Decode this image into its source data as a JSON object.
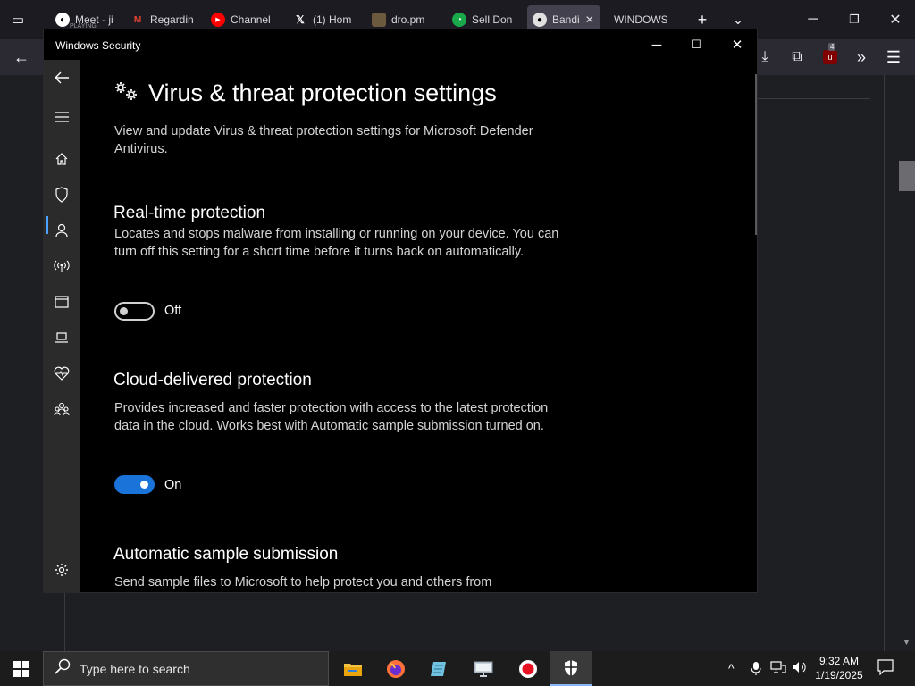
{
  "browser": {
    "tabs": [
      {
        "label": "Meet - ji",
        "sub": "PLAYING",
        "icon": "meet-icon"
      },
      {
        "label": "Regardin",
        "icon": "gmail-icon"
      },
      {
        "label": "Channel",
        "icon": "youtube-icon"
      },
      {
        "label": "(1) Hom",
        "icon": "x-icon"
      },
      {
        "label": "dro.pm",
        "icon": "dropm-icon"
      },
      {
        "label": "Sell Don",
        "icon": "sell-icon"
      },
      {
        "label": "Bandi",
        "icon": "github-icon",
        "active": true
      },
      {
        "label": "WINDOWS",
        "icon": ""
      }
    ],
    "new_tab": "+",
    "badge_count": "4"
  },
  "window": {
    "title": "Windows Security",
    "page_title": "Virus & threat protection settings",
    "page_desc": "View and update Virus & threat protection settings for Microsoft Defender Antivirus.",
    "sections": [
      {
        "heading": "Real-time protection",
        "description": "Locates and stops malware from installing or running on your device. You can turn off this setting for a short time before it turns back on automatically.",
        "toggle_state": "Off"
      },
      {
        "heading": "Cloud-delivered protection",
        "description": "Provides increased and faster protection with access to the latest protection data in the cloud. Works best with Automatic sample submission turned on.",
        "toggle_state": "On"
      },
      {
        "heading": "Automatic sample submission",
        "description": "Send sample files to Microsoft to help protect you and others from"
      }
    ]
  },
  "taskbar": {
    "search_placeholder": "Type here to search",
    "time": "9:32 AM",
    "date": "1/19/2025"
  },
  "colors": {
    "accent": "#1a73d9",
    "window_bg": "#000000",
    "nav_bg": "#2b2b2b"
  }
}
